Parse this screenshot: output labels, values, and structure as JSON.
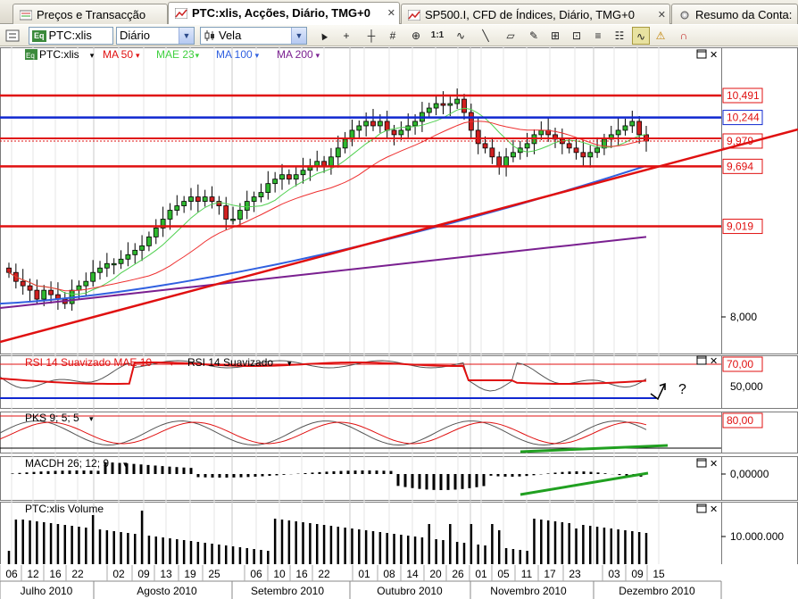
{
  "tabs": [
    {
      "label": "Preços e Transacção",
      "active": false
    },
    {
      "label": "PTC:xlis, Acções, Diário, TMG+0",
      "active": true
    },
    {
      "label": "SP500.I, CFD de Índices, Diário, TMG+0",
      "active": false
    },
    {
      "label": "Resumo da Conta:",
      "active": false
    }
  ],
  "tab_close_glyph": "✕",
  "toolbar": {
    "symbol_value": "PTC:xlis",
    "symbol_badge": "Eq",
    "period_value": "Diário",
    "chart_type_value": "Vela",
    "tool_icons": [
      "cursor-icon",
      "crosshair-icon",
      "plus-icon",
      "grid-icon",
      "zoom-icon",
      "ratio-icon",
      "wave-icon",
      "line-icon",
      "eraser-icon",
      "draw-icon",
      "pattern-icon",
      "chart-icon",
      "lines-icon",
      "settings-icon",
      "indicator-icon",
      "alert-icon",
      "magnet-icon"
    ],
    "ratio_label": "1:1"
  },
  "price_panel": {
    "legend": [
      {
        "label": "PTC:xlis",
        "color": "#000000",
        "badge": "Eq"
      },
      {
        "label": "MA 50",
        "color": "#e01010"
      },
      {
        "label": "MAE 23",
        "color": "#40d040"
      },
      {
        "label": "MA 100",
        "color": "#3060e0"
      },
      {
        "label": "MA 200",
        "color": "#7a2090"
      }
    ],
    "levels": [
      {
        "value": "10,491",
        "price": 10.491,
        "color": "#e01010"
      },
      {
        "value": "10,244",
        "price": 10.244,
        "color": "#1028d0"
      },
      {
        "value": "9,979",
        "price": 9.979,
        "color": "#e01010"
      },
      {
        "value": "9,694",
        "price": 9.694,
        "color": "#e01010"
      },
      {
        "value": "9,019",
        "price": 9.019,
        "color": "#e01010"
      }
    ],
    "axis_label": "8,000"
  },
  "rsi_panel": {
    "title": "RSI 14 Suavizado MAE 10",
    "subtitle": "RSI 14 Suavizado",
    "levels": [
      "70,00",
      "50,000"
    ],
    "annotation": "?"
  },
  "pks_panel": {
    "title": "PKS 9; 5; 5",
    "level": "80,00"
  },
  "macd_panel": {
    "title": "MACDH 26; 12; 9",
    "level": "0,00000"
  },
  "volume_panel": {
    "title": "PTC:xlis Volume",
    "level": "10.000.000"
  },
  "x_axis": {
    "days": [
      "06",
      "12",
      "16",
      "22",
      "02",
      "09",
      "13",
      "19",
      "25",
      "06",
      "10",
      "16",
      "22",
      "01",
      "08",
      "14",
      "20",
      "26",
      "01",
      "05",
      "11",
      "17",
      "23",
      "03",
      "09",
      "15"
    ],
    "months": [
      "Julho 2010",
      "Agosto 2010",
      "Setembro 2010",
      "Outubro 2010",
      "Novembro 2010",
      "Dezembro 2010"
    ]
  },
  "chart_data": {
    "type": "candlestick",
    "symbol": "PTC:xlis",
    "period": "Diário",
    "y_levels": [
      10.491,
      10.244,
      9.979,
      9.694,
      9.019,
      8.0
    ],
    "approx_closes": [
      8.5,
      8.4,
      8.35,
      8.3,
      8.2,
      8.3,
      8.25,
      8.2,
      8.15,
      8.3,
      8.35,
      8.4,
      8.5,
      8.55,
      8.6,
      8.6,
      8.65,
      8.7,
      8.75,
      8.8,
      8.9,
      9.0,
      9.1,
      9.2,
      9.25,
      9.3,
      9.35,
      9.3,
      9.35,
      9.3,
      9.25,
      9.1,
      9.1,
      9.2,
      9.3,
      9.35,
      9.4,
      9.5,
      9.55,
      9.6,
      9.55,
      9.6,
      9.65,
      9.7,
      9.75,
      9.7,
      9.8,
      9.9,
      10.0,
      10.1,
      10.15,
      10.2,
      10.15,
      10.2,
      10.1,
      10.05,
      10.1,
      10.15,
      10.2,
      10.3,
      10.35,
      10.4,
      10.38,
      10.4,
      10.45,
      10.3,
      10.1,
      9.95,
      9.9,
      9.8,
      9.7,
      9.8,
      9.85,
      9.9,
      9.95,
      10.05,
      10.1,
      10.05,
      10.0,
      9.95,
      9.9,
      9.85,
      9.8,
      9.85,
      9.9,
      10.0,
      10.05,
      10.1,
      10.15,
      10.2,
      10.05,
      9.979
    ]
  }
}
